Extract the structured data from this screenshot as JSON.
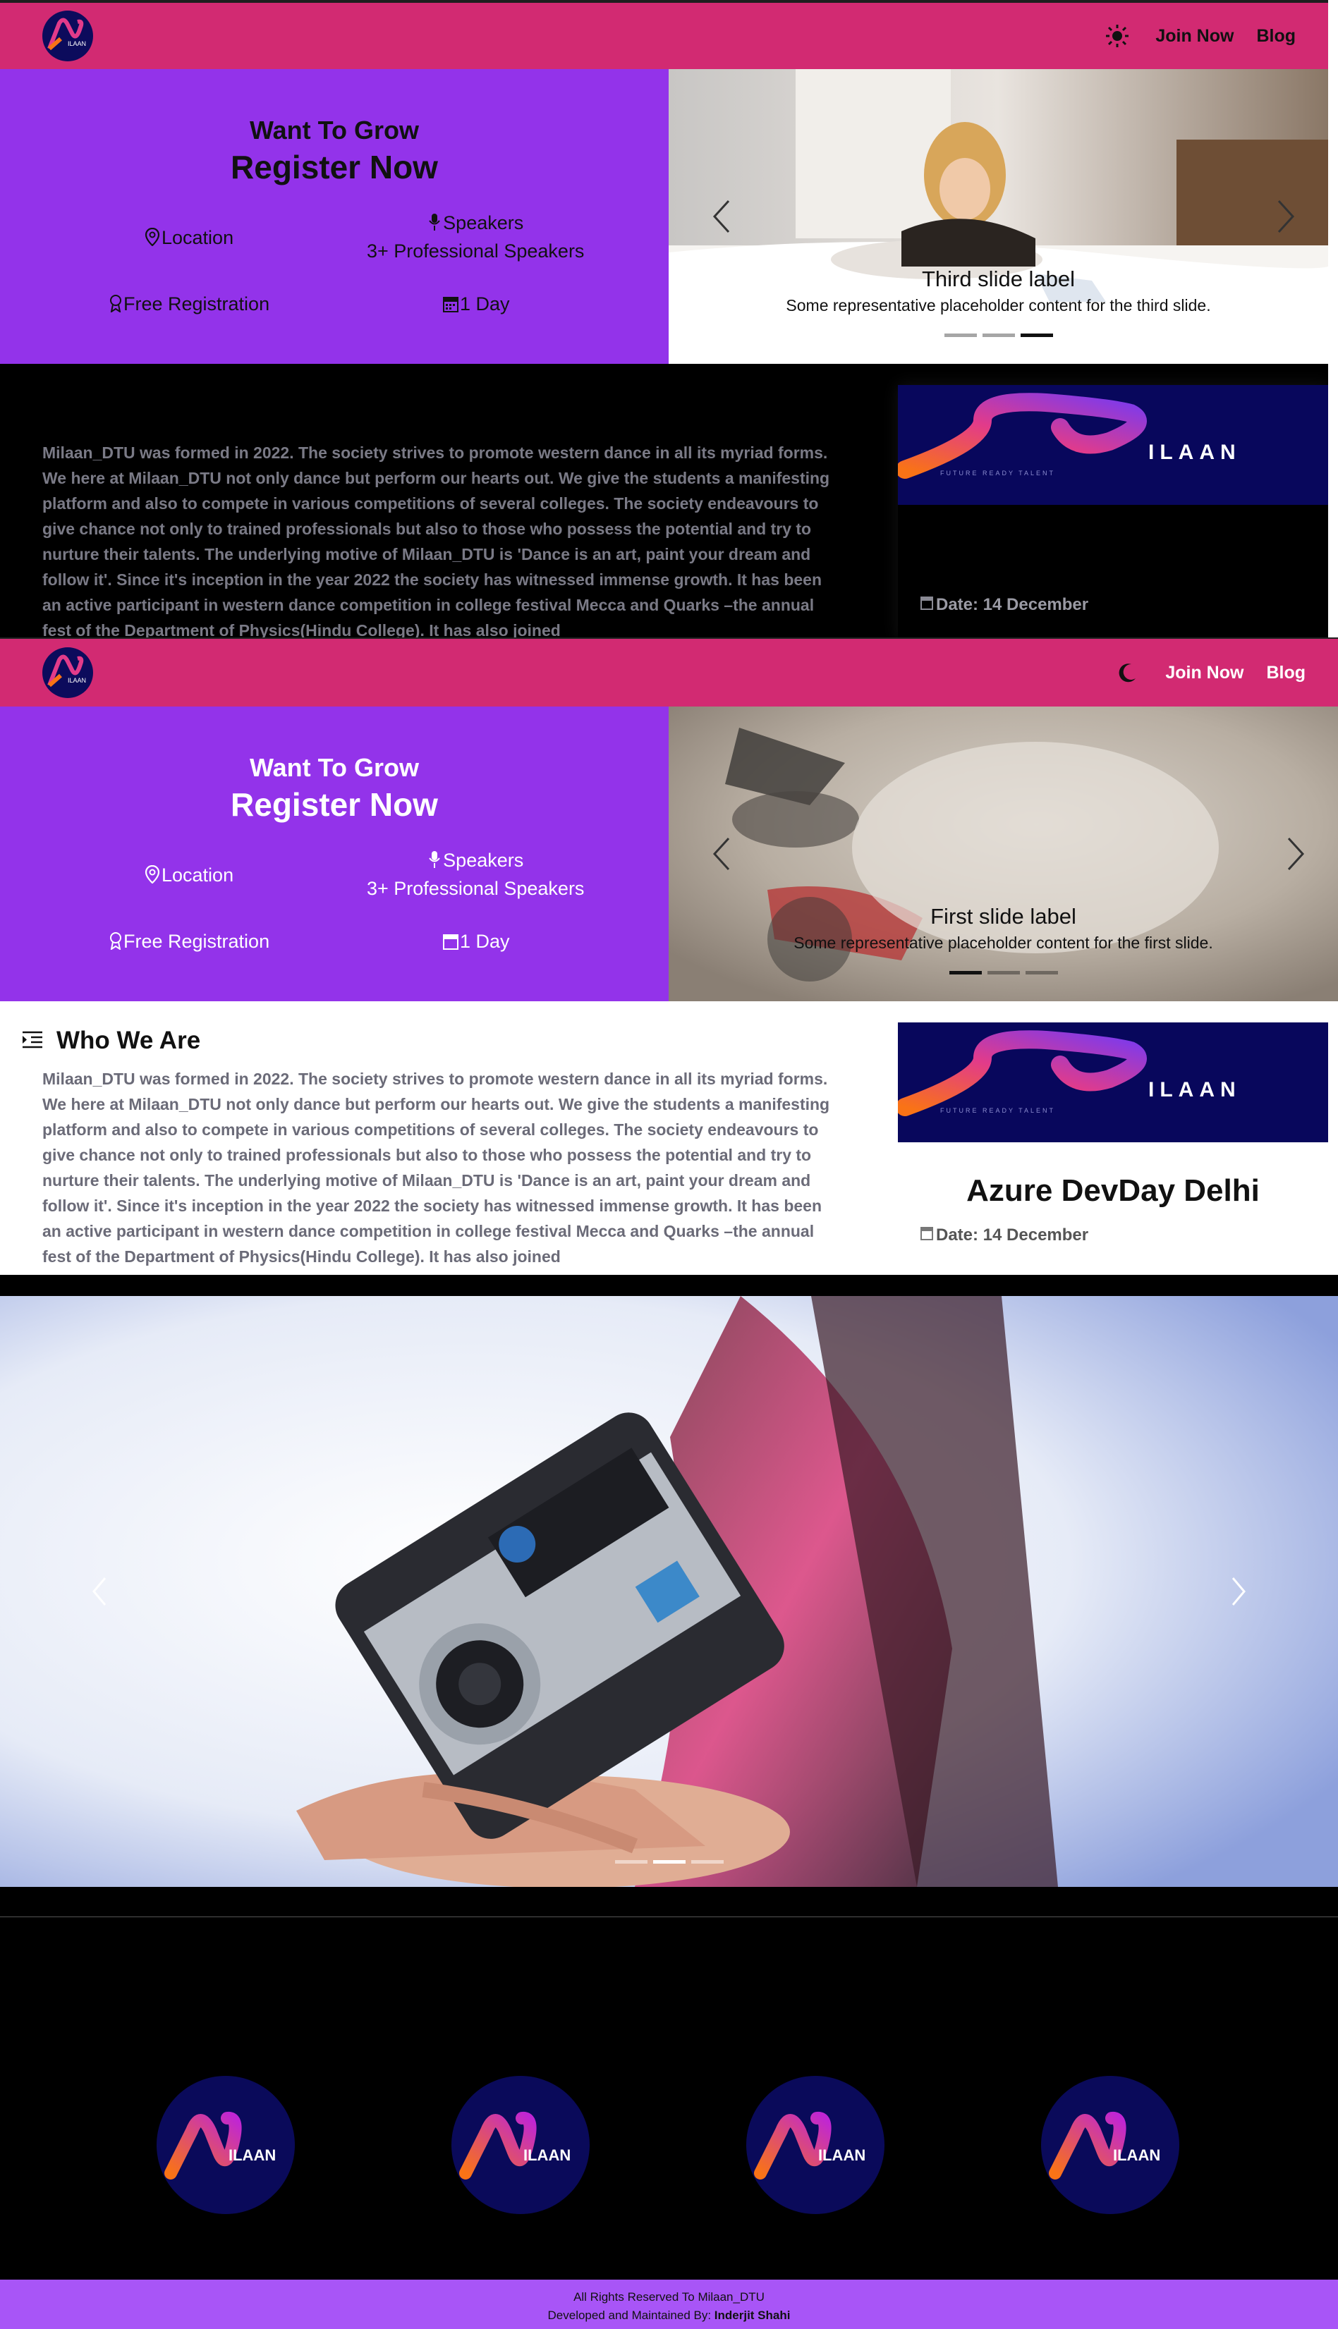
{
  "nav": {
    "join_label": "Join Now",
    "blog_label": "Blog",
    "theme_icon_light": "sun-icon",
    "theme_icon_dark": "moon-icon",
    "logo_text": "ILAAN"
  },
  "hero": {
    "line1": "Want To Grow",
    "line2": "Register Now",
    "location_label": "Location",
    "speakers_label": "Speakers",
    "speakers_detail": "3+ Professional Speakers",
    "registration_label": "Free Registration",
    "duration_label": "1 Day"
  },
  "carousel_view1": {
    "caption_title": "Third slide label",
    "caption_text": "Some representative placeholder content for the third slide.",
    "active_index": 2,
    "count": 3
  },
  "carousel_view2": {
    "caption_title": "First slide label",
    "caption_text": "Some representative placeholder content for the first slide.",
    "active_index": 0,
    "count": 3
  },
  "about": {
    "title": "Who We Are",
    "paragraph": "Milaan_DTU was formed in 2022. The society strives to promote western dance in all its myriad forms. We here at Milaan_DTU not only dance but perform our hearts out. We give the students a manifesting platform and also to compete in various competitions of several colleges. The society endeavours to give chance not only to trained professionals but also to those who possess the potential and try to nurture their talents. The underlying motive of Milaan_DTU is 'Dance is an art, paint your dream and follow it'. Since it's inception in the year 2022 the society has witnessed immense growth. It has been an active participant in western dance competition in college festival Mecca and Quarks –the annual fest of the Department of Physics(Hindu College). It has also joined"
  },
  "event": {
    "title": "Azure DevDay Delhi",
    "date": "Date: 14 December",
    "banner_text": "ILAAN",
    "banner_tagline": "FUTURE READY TALENT"
  },
  "gallery": {
    "active_index": 1,
    "count": 3
  },
  "team": {
    "members": [
      "ILAAN",
      "ILAAN",
      "ILAAN",
      "ILAAN"
    ]
  },
  "footer": {
    "line1": "All Rights Reserved To Milaan_DTU",
    "line2_prefix": "Developed and Maintained By: ",
    "line2_name": "Inderjit Shahi"
  },
  "colors": {
    "navbar": "#d22a72",
    "hero_left": "#9333ea",
    "footer": "#a855f7",
    "logo_bg": "#0c0b5c"
  }
}
